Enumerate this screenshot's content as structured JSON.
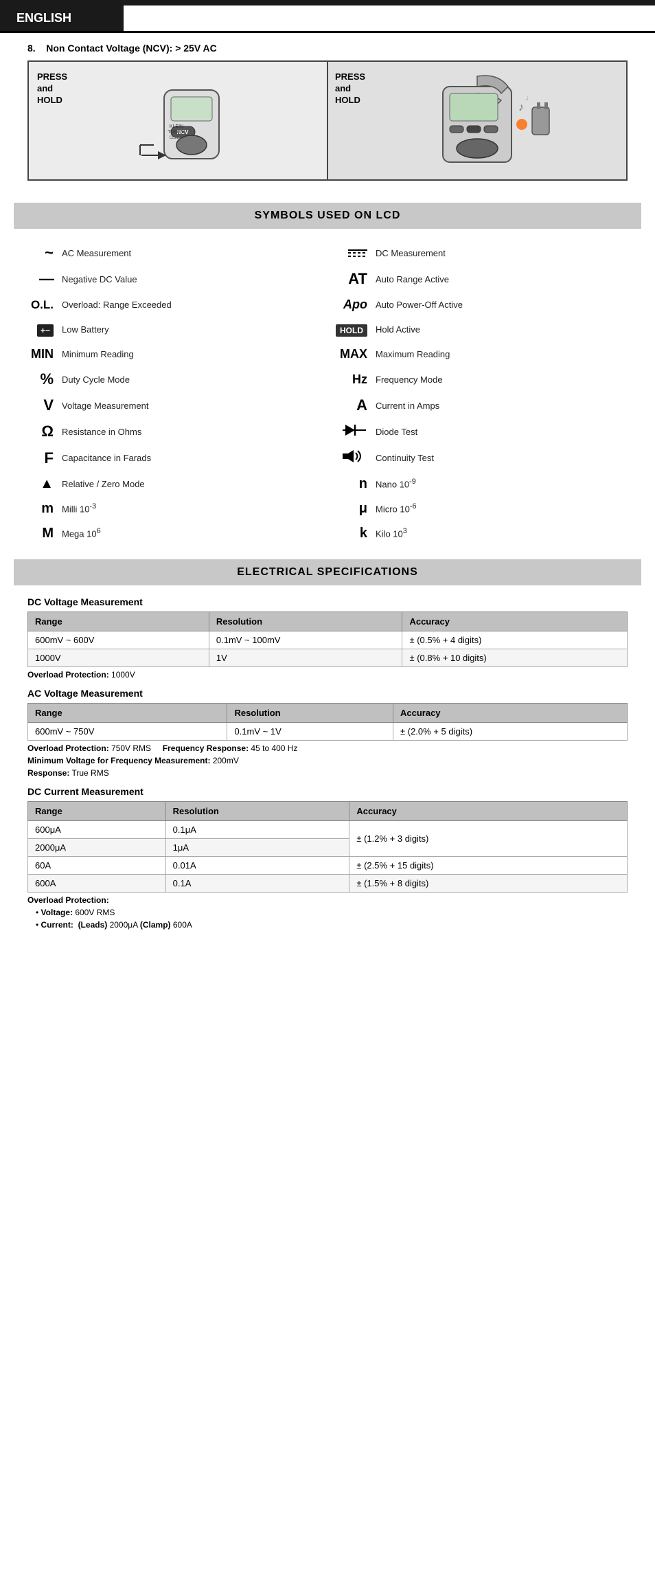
{
  "header": {
    "language": "ENGLISH"
  },
  "ncv_section": {
    "item_number": "8.",
    "title": "Non Contact Voltage (NCV): > 25V AC",
    "left_label_line1": "PRESS",
    "left_label_line2": "and",
    "left_label_line3": "HOLD",
    "right_label_line1": "PRESS",
    "right_label_line2": "and",
    "right_label_line3": "HOLD"
  },
  "symbols_section": {
    "title": "SYMBOLS USED ON LCD",
    "symbols": [
      {
        "icon": "~",
        "label": "AC Measurement",
        "type": "tilde"
      },
      {
        "icon": "DC",
        "label": "DC Measurement",
        "type": "dc-lines"
      },
      {
        "icon": "—",
        "label": "Negative DC Value",
        "type": "dash"
      },
      {
        "icon": "AT",
        "label": "Auto Range Active",
        "type": "text"
      },
      {
        "icon": "O.L.",
        "label": "Overload: Range Exceeded",
        "type": "text"
      },
      {
        "icon": "Apo",
        "label": "Auto Power-Off Active",
        "type": "text"
      },
      {
        "icon": "battery",
        "label": "Low Battery",
        "type": "battery"
      },
      {
        "icon": "HOLD",
        "label": "Hold Active",
        "type": "hold"
      },
      {
        "icon": "MIN",
        "label": "Minimum Reading",
        "type": "text"
      },
      {
        "icon": "MAX",
        "label": "Maximum Reading",
        "type": "text"
      },
      {
        "icon": "%",
        "label": "Duty Cycle Mode",
        "type": "text"
      },
      {
        "icon": "Hz",
        "label": "Frequency Mode",
        "type": "text"
      },
      {
        "icon": "V",
        "label": "Voltage Measurement",
        "type": "text"
      },
      {
        "icon": "A",
        "label": "Current in Amps",
        "type": "text"
      },
      {
        "icon": "Ω",
        "label": "Resistance in Ohms",
        "type": "text"
      },
      {
        "icon": "diode",
        "label": "Diode Test",
        "type": "diode"
      },
      {
        "icon": "F",
        "label": "Capacitance in Farads",
        "type": "text"
      },
      {
        "icon": "cont",
        "label": "Continuity Test",
        "type": "continuity"
      },
      {
        "icon": "▲",
        "label": "Relative / Zero Mode",
        "type": "text"
      },
      {
        "icon": "n",
        "label": "Nano 10⁻⁹",
        "type": "text",
        "super": "-9"
      },
      {
        "icon": "m",
        "label": "Milli 10⁻³",
        "type": "text",
        "super": "-3"
      },
      {
        "icon": "μ",
        "label": "Micro 10⁻⁶",
        "type": "text",
        "super": "-6"
      },
      {
        "icon": "M",
        "label": "Mega 10⁶",
        "type": "text",
        "super": "6"
      },
      {
        "icon": "k",
        "label": "Kilo 10³",
        "type": "text",
        "super": "3"
      }
    ]
  },
  "electrical_specs": {
    "title": "ELECTRICAL SPECIFICATIONS",
    "sections": [
      {
        "title": "DC Voltage Measurement",
        "headers": [
          "Range",
          "Resolution",
          "Accuracy"
        ],
        "rows": [
          [
            "600mV ~ 600V",
            "0.1mV ~ 100mV",
            "± (0.5% + 4 digits)"
          ],
          [
            "1000V",
            "1V",
            "± (0.8% + 10 digits)"
          ]
        ],
        "notes": [
          {
            "label": "Overload Protection:",
            "value": "1000V"
          }
        ]
      },
      {
        "title": "AC Voltage Measurement",
        "headers": [
          "Range",
          "Resolution",
          "Accuracy"
        ],
        "rows": [
          [
            "600mV ~ 750V",
            "0.1mV ~ 1V",
            "± (2.0% + 5 digits)"
          ]
        ],
        "notes": [
          {
            "label": "Overload Protection:",
            "value": "750V RMS",
            "extra_label": "Frequency Response:",
            "extra_value": "45 to 400 Hz"
          },
          {
            "label": "Minimum Voltage for Frequency Measurement:",
            "value": "200mV"
          },
          {
            "label": "Response:",
            "value": "True RMS"
          }
        ]
      },
      {
        "title": "DC Current Measurement",
        "headers": [
          "Range",
          "Resolution",
          "Accuracy"
        ],
        "rows": [
          [
            "600μA",
            "0.1μA",
            "± (1.2% + 3 digits)",
            "rowspan2"
          ],
          [
            "2000μA",
            "1μA",
            ""
          ],
          [
            "60A",
            "0.01A",
            "± (2.5% + 15 digits)"
          ],
          [
            "600A",
            "0.1A",
            "± (1.5% + 8 digits)"
          ]
        ],
        "notes": [
          {
            "label": "Overload Protection:",
            "value": ""
          },
          {
            "label": "• Voltage:",
            "value": "600V RMS"
          },
          {
            "label": "• Current:",
            "value": "(Leads) 2000μA (Clamp) 600A",
            "bold_parts": [
              "(Leads)",
              "(Clamp)"
            ]
          }
        ]
      }
    ]
  }
}
